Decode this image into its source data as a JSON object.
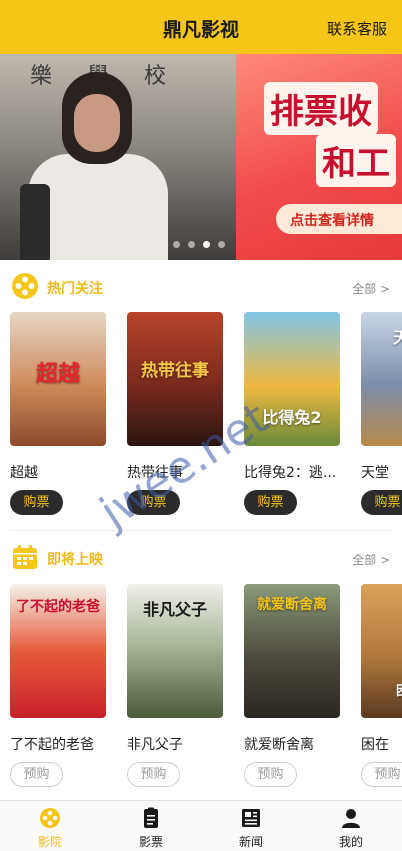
{
  "header": {
    "title": "鼎凡影视",
    "service_label": "联系客服"
  },
  "banner": {
    "slide_left_sign": "樂 學 校",
    "slide_right_line1": "排票收",
    "slide_right_line2": "和工",
    "slide_right_cta": "点击查看详情",
    "dot_count": 4,
    "active_dot": 3
  },
  "hot": {
    "title": "热门关注",
    "more": "全部 >",
    "movies": [
      {
        "name": "超越",
        "poster_text": "超越",
        "action": "购票",
        "poster_color": "#cf8a5a"
      },
      {
        "name": "热带往事",
        "poster_text": "热带往事",
        "action": "购票",
        "poster_color": "#7a2a1e"
      },
      {
        "name": "比得兔2：逃...",
        "poster_text": "比得兔2",
        "action": "购票",
        "poster_color": "#f0b840"
      },
      {
        "name": "天堂",
        "poster_text": "天堂",
        "action": "购票",
        "poster_color": "#7c8da8"
      }
    ]
  },
  "upcoming": {
    "title": "即将上映",
    "more": "全部 >",
    "movies": [
      {
        "name": "了不起的老爸",
        "poster_text": "了不起的老爸",
        "action": "预购",
        "poster_color": "#d33a2a"
      },
      {
        "name": "非凡父子",
        "poster_text": "非凡父子",
        "action": "预购",
        "poster_color": "#6b7d5a"
      },
      {
        "name": "就爱断舍离",
        "poster_text": "就爱断舍离",
        "action": "预购",
        "poster_color": "#4e4a3e"
      },
      {
        "name": "困在",
        "poster_text": "困在",
        "action": "预购",
        "poster_color": "#b0773c"
      }
    ]
  },
  "tabbar": {
    "items": [
      {
        "label": "影院",
        "icon": "film-reel-icon"
      },
      {
        "label": "影票",
        "icon": "ticket-icon"
      },
      {
        "label": "新闻",
        "icon": "newspaper-icon"
      },
      {
        "label": "我的",
        "icon": "user-icon"
      }
    ],
    "active": 0
  },
  "watermark": "jwee.net",
  "colors": {
    "accent": "#f5c518",
    "section_title": "#f0b91a",
    "buy_button_bg": "#2b2b2b",
    "buy_button_text": "#f5c518"
  }
}
